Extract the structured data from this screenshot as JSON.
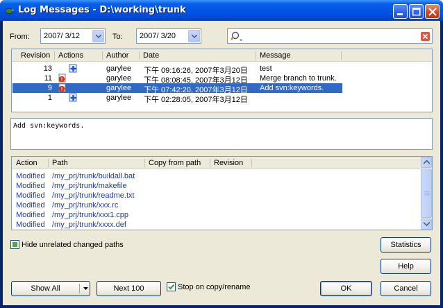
{
  "window": {
    "title": "Log Messages - D:\\working\\trunk",
    "accent": "#0055e5"
  },
  "filters": {
    "from_label": "From:",
    "from_date": "2007/ 3/12",
    "to_label": "To:",
    "to_date": "2007/ 3/20",
    "search_value": ""
  },
  "log": {
    "headers": [
      "Revision",
      "Actions",
      "Author",
      "Date",
      "Message"
    ],
    "rows": [
      {
        "revision": "13",
        "action_icon": "add-icon",
        "author": "garylee",
        "date": "下午 09:16:26, 2007年3月20日",
        "message": "test",
        "selected": false
      },
      {
        "revision": "11",
        "action_icon": "modify-icon",
        "author": "garylee",
        "date": "下午 08:08:45, 2007年3月12日",
        "message": "Merge branch to trunk.",
        "selected": false
      },
      {
        "revision": "9",
        "action_icon": "modify-icon",
        "author": "garylee",
        "date": "下午 07:42:20, 2007年3月12日",
        "message": "Add svn:keywords.",
        "selected": true
      },
      {
        "revision": "1",
        "action_icon": "add-icon",
        "author": "garylee",
        "date": "下午 02:28:05, 2007年3月12日",
        "message": "",
        "selected": false
      }
    ]
  },
  "message_text": "Add svn:keywords.",
  "paths": {
    "headers": [
      "Action",
      "Path",
      "Copy from path",
      "Revision"
    ],
    "rows": [
      {
        "action": "Modified",
        "path": "/my_prj/trunk/buildall.bat"
      },
      {
        "action": "Modified",
        "path": "/my_prj/trunk/makefile"
      },
      {
        "action": "Modified",
        "path": "/my_prj/trunk/readme.txt"
      },
      {
        "action": "Modified",
        "path": "/my_prj/trunk/xxx.rc"
      },
      {
        "action": "Modified",
        "path": "/my_prj/trunk/xxx1.cpp"
      },
      {
        "action": "Modified",
        "path": "/my_prj/trunk/xxxx.def"
      }
    ]
  },
  "options": {
    "hide_unrelated_label": "Hide unrelated changed paths",
    "stop_on_copy_label": "Stop on copy/rename",
    "stop_on_copy_checked": true
  },
  "buttons": {
    "statistics": "Statistics",
    "help": "Help",
    "show_all": "Show All",
    "next_100": "Next 100",
    "ok": "OK",
    "cancel": "Cancel"
  }
}
